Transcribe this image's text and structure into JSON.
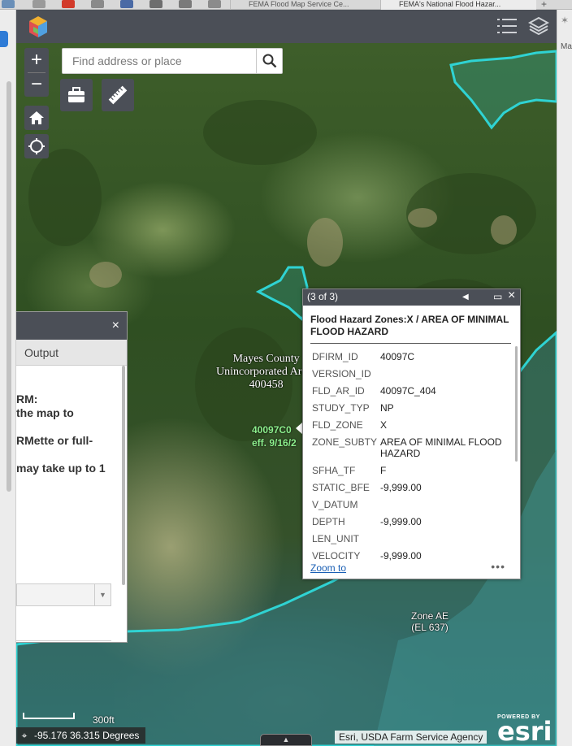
{
  "browser": {
    "tabs": [
      {
        "label": "FEMA Flood Map Service Ce..."
      },
      {
        "label": "FEMA's National Flood Hazar..."
      }
    ],
    "new_tab": "+",
    "sidebar_text": "Ma"
  },
  "search": {
    "placeholder": "Find address or place"
  },
  "map_labels": {
    "county": [
      "Mayes County",
      "Unincorporated Areas",
      "400458"
    ],
    "panel": [
      "40097C0",
      "eff. 9/16/2"
    ],
    "zone_ae": [
      "Zone AE",
      "(EL 637)"
    ]
  },
  "left_panel": {
    "tab_output": "Output",
    "lines": [
      "RM:",
      "the map to",
      "RMette or full-",
      "may take up to 1"
    ]
  },
  "popup": {
    "counter": "(3 of 3)",
    "title": "Flood Hazard Zones:X / AREA OF MINIMAL FLOOD HAZARD",
    "fields": [
      {
        "key": "DFIRM_ID",
        "value": "40097C"
      },
      {
        "key": "VERSION_ID",
        "value": ""
      },
      {
        "key": "FLD_AR_ID",
        "value": "40097C_404"
      },
      {
        "key": "STUDY_TYP",
        "value": "NP"
      },
      {
        "key": "FLD_ZONE",
        "value": "X"
      },
      {
        "key": "ZONE_SUBTY",
        "value": "AREA OF MINIMAL FLOOD HAZARD"
      },
      {
        "key": "SFHA_TF",
        "value": "F"
      },
      {
        "key": "STATIC_BFE",
        "value": "-9,999.00"
      },
      {
        "key": "V_DATUM",
        "value": ""
      },
      {
        "key": "DEPTH",
        "value": "-9,999.00"
      },
      {
        "key": "LEN_UNIT",
        "value": ""
      },
      {
        "key": "VELOCITY",
        "value": "-9,999.00"
      }
    ],
    "zoom_to": "Zoom to",
    "more": "•••"
  },
  "scale": {
    "label": "300ft"
  },
  "coordinates": "-95.176 36.315 Degrees",
  "attribution": "Esri, USDA Farm Service Agency",
  "esri_logo": {
    "powered_by": "POWERED BY",
    "wordmark": "esri"
  },
  "icons": {
    "zoom_in": "+",
    "zoom_out": "−",
    "close": "×",
    "prev": "◀",
    "maximize": "▭",
    "caret": "▲"
  },
  "colors": {
    "flood_outline": "#2fd3d3",
    "header": "#4b4f57",
    "panel_label": "#8df08d"
  }
}
